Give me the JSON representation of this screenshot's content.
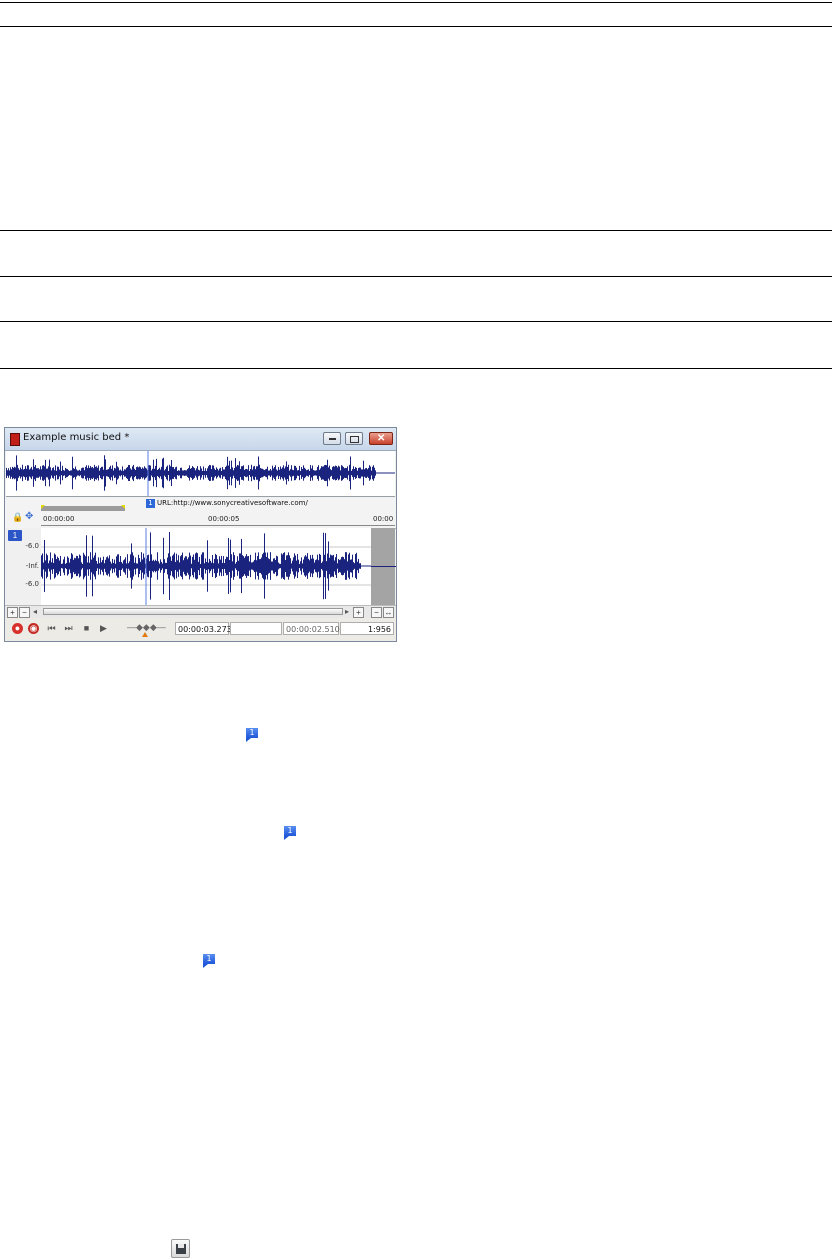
{
  "window": {
    "title": "Example music bed *",
    "close_glyph": "✕",
    "marker": {
      "number": "1",
      "text": "URL:http://www.sonycreativesoftware.com/"
    },
    "ruler_ticks": [
      "00:00:00",
      "00:00:05",
      "00:00"
    ],
    "channel_number": "1",
    "db_labels": [
      "-6.0",
      "-Inf.",
      "-6.0"
    ],
    "transport": {
      "position": "00:00:03.273",
      "selection_start": "",
      "selection_length": "00:00:02.510",
      "zoom": "1:956"
    },
    "icons": [
      "lock-icon",
      "snap-icon",
      "record-icon",
      "loop-record-icon",
      "go-to-start-icon",
      "go-to-end-icon",
      "stop-icon",
      "play-icon",
      "playbar-shuttle-icon"
    ]
  },
  "inline_marker_icons": [
    "1",
    "1",
    "1"
  ],
  "save_icon": "floppy-disk-icon"
}
